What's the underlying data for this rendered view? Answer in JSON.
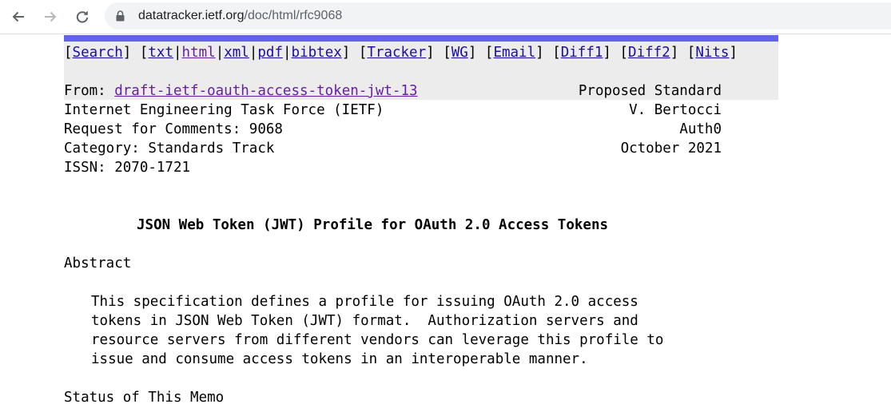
{
  "browser": {
    "url_host": "datatracker.ietf.org",
    "url_path": "/doc/html/rfc9068"
  },
  "nav": {
    "links": [
      "Search",
      "txt",
      "html",
      "xml",
      "pdf",
      "bibtex",
      "Tracker",
      "WG",
      "Email",
      "Diff1",
      "Diff2",
      "Nits"
    ]
  },
  "header": {
    "from_label": "From: ",
    "from_link": "draft-ietf-oauth-access-token-jwt-13",
    "status": "Proposed Standard",
    "org": "Internet Engineering Task Force (IETF)",
    "author": "V. Bertocci",
    "rfc": "Request for Comments: 9068",
    "affiliation": "Auth0",
    "category": "Category: Standards Track",
    "date": "October 2021",
    "issn": "ISSN: 2070-1721"
  },
  "document": {
    "title": "JSON Web Token (JWT) Profile for OAuth 2.0 Access Tokens",
    "abstract_heading": "Abstract",
    "abstract_lines": [
      "This specification defines a profile for issuing OAuth 2.0 access",
      "tokens in JSON Web Token (JWT) format.  Authorization servers and",
      "resource servers from different vendors can leverage this profile to",
      "issue and consume access tokens in an interoperable manner."
    ],
    "status_heading": "Status of This Memo"
  },
  "colors": {
    "link": "#1a0dab",
    "visited_link": "#681da8",
    "header_bar": "#6262ef",
    "header_bg": "#ececec"
  }
}
